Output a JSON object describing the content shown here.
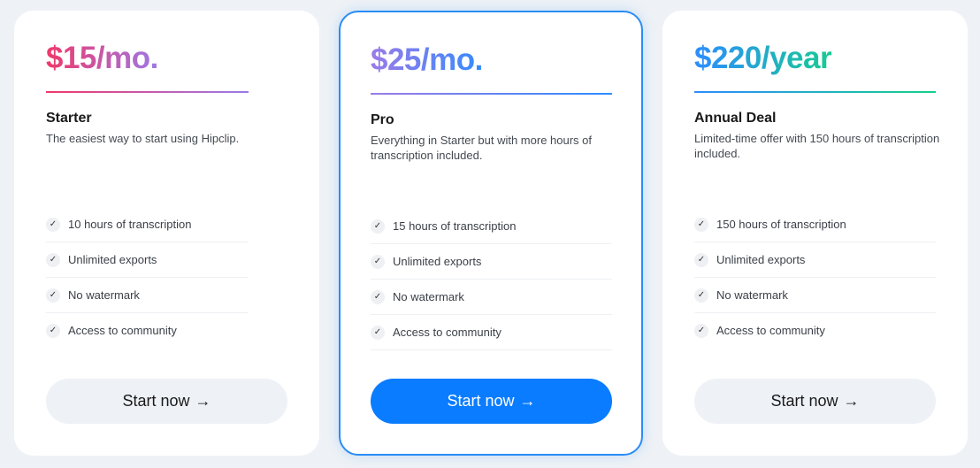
{
  "plans": [
    {
      "price": "$15/mo.",
      "name": "Starter",
      "description": "The easiest way to start using Hipclip.",
      "features": [
        "10 hours of transcription",
        "Unlimited exports",
        "No watermark",
        "Access to community"
      ],
      "button_label": "Start now",
      "button_arrow": "→",
      "gradient": [
        "#f0386b",
        "#9b7be8"
      ],
      "highlighted": false
    },
    {
      "price": "$25/mo.",
      "name": "Pro",
      "description": "Everything in Starter but with more hours of transcription included.",
      "features": [
        "15 hours of transcription",
        "Unlimited exports",
        "No watermark",
        "Access to community"
      ],
      "button_label": "Start now",
      "button_arrow": "→",
      "gradient": [
        "#9b7be8",
        "#2d8cff"
      ],
      "highlighted": true
    },
    {
      "price": "$220/year",
      "name": "Annual Deal",
      "description": "Limited-time offer with 150 hours of transcription included.",
      "features": [
        "150 hours of transcription",
        "Unlimited exports",
        "No watermark",
        "Access to community"
      ],
      "button_label": "Start now",
      "button_arrow": "→",
      "gradient": [
        "#2d8cff",
        "#16d08a"
      ],
      "highlighted": false
    }
  ],
  "icons": {
    "feature_check": "✓"
  },
  "colors": {
    "accent": "#0a7cff",
    "highlight_border": "#2a8cf5",
    "background": "#eef2f6"
  }
}
